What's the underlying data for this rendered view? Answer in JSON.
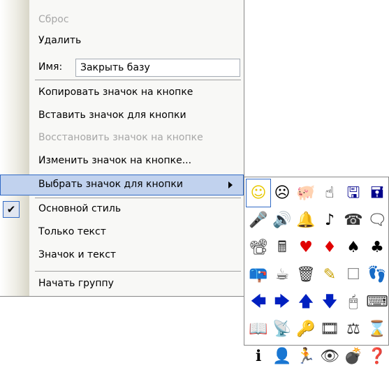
{
  "menu": {
    "reset": "Сброс",
    "delete": "Удалить",
    "name_label": "Имя:",
    "name_value": "Закрыть базу",
    "copy_icon": "Копировать значок на кнопке",
    "paste_icon": "Вставить значок для кнопки",
    "restore_icon": "Восстановить значок на кнопке",
    "edit_icon": "Изменить значок на кнопке...",
    "choose_icon": "Выбрать значок для кнопки",
    "default_style": "Основной стиль",
    "text_only": "Только текст",
    "icon_and_text": "Значок и текст",
    "begin_group": "Начать группу",
    "checked_mark": "✔"
  },
  "icon_picker": {
    "icons": [
      {
        "name": "smiley-icon",
        "glyph": "☺",
        "color": "#e8c800"
      },
      {
        "name": "sad-face-icon",
        "glyph": "☹",
        "color": "#000000"
      },
      {
        "name": "piggy-bank-icon",
        "glyph": "🐖",
        "color": "#555555"
      },
      {
        "name": "hand-pointer-icon",
        "glyph": "☝",
        "color": "#000000"
      },
      {
        "name": "floppy-disk-icon",
        "glyph": "🖫",
        "color": "#00008b"
      },
      {
        "name": "floppy-disk-alt-icon",
        "glyph": "🖬",
        "color": "#00008b"
      },
      {
        "name": "microphone-icon",
        "glyph": "🎤",
        "color": "#333333"
      },
      {
        "name": "speaker-icon",
        "glyph": "🔊",
        "color": "#333333"
      },
      {
        "name": "bell-icon",
        "glyph": "🔔",
        "color": "#333333"
      },
      {
        "name": "music-note-icon",
        "glyph": "♪",
        "color": "#000000"
      },
      {
        "name": "telephone-icon",
        "glyph": "☎",
        "color": "#333333"
      },
      {
        "name": "speech-bubble-icon",
        "glyph": "🗨",
        "color": "#333333"
      },
      {
        "name": "projector-icon",
        "glyph": "📽",
        "color": "#333333"
      },
      {
        "name": "calculator-icon",
        "glyph": "🖩",
        "color": "#333333"
      },
      {
        "name": "heart-icon",
        "glyph": "♥",
        "color": "#e00000"
      },
      {
        "name": "diamond-icon",
        "glyph": "♦",
        "color": "#e00000"
      },
      {
        "name": "spade-icon",
        "glyph": "♠",
        "color": "#000000"
      },
      {
        "name": "club-icon",
        "glyph": "♣",
        "color": "#000000"
      },
      {
        "name": "mailbox-icon",
        "glyph": "📪",
        "color": "#1a1a8a"
      },
      {
        "name": "cup-icon",
        "glyph": "☕",
        "color": "#333333"
      },
      {
        "name": "trash-can-icon",
        "glyph": "🗑",
        "color": "#333333"
      },
      {
        "name": "pencil-icon",
        "glyph": "✎",
        "color": "#c8a000"
      },
      {
        "name": "blank-square-icon",
        "glyph": "☐",
        "color": "#888888"
      },
      {
        "name": "footprints-icon",
        "glyph": "👣",
        "color": "#333333"
      },
      {
        "name": "arrow-left-icon",
        "glyph": "🡄",
        "color": "#0020c0"
      },
      {
        "name": "arrow-right-icon",
        "glyph": "🡆",
        "color": "#0020c0"
      },
      {
        "name": "arrow-up-icon",
        "glyph": "🡅",
        "color": "#0020c0"
      },
      {
        "name": "arrow-down-icon",
        "glyph": "🡇",
        "color": "#0020c0"
      },
      {
        "name": "mouse-icon",
        "glyph": "🖱",
        "color": "#333333"
      },
      {
        "name": "keyboard-icon",
        "glyph": "⌨",
        "color": "#333333"
      },
      {
        "name": "book-icon",
        "glyph": "📖",
        "color": "#333333"
      },
      {
        "name": "signal-waves-icon",
        "glyph": "📡",
        "color": "#333333"
      },
      {
        "name": "key-icon",
        "glyph": "🔑",
        "color": "#000000"
      },
      {
        "name": "film-reel-icon",
        "glyph": "🎞",
        "color": "#333333"
      },
      {
        "name": "scales-icon",
        "glyph": "⚖",
        "color": "#333333"
      },
      {
        "name": "hourglass-icon",
        "glyph": "⌛",
        "color": "#555555"
      },
      {
        "name": "info-person-icon",
        "glyph": "ℹ",
        "color": "#000000"
      },
      {
        "name": "head-silhouette-icon",
        "glyph": "👤",
        "color": "#000000"
      },
      {
        "name": "running-person-icon",
        "glyph": "🏃",
        "color": "#333333"
      },
      {
        "name": "eye-icon",
        "glyph": "👁",
        "color": "#333333"
      },
      {
        "name": "bomb-icon",
        "glyph": "💣",
        "color": "#000000"
      },
      {
        "name": "help-question-icon",
        "glyph": "❓",
        "color": "#d4b000"
      }
    ]
  }
}
